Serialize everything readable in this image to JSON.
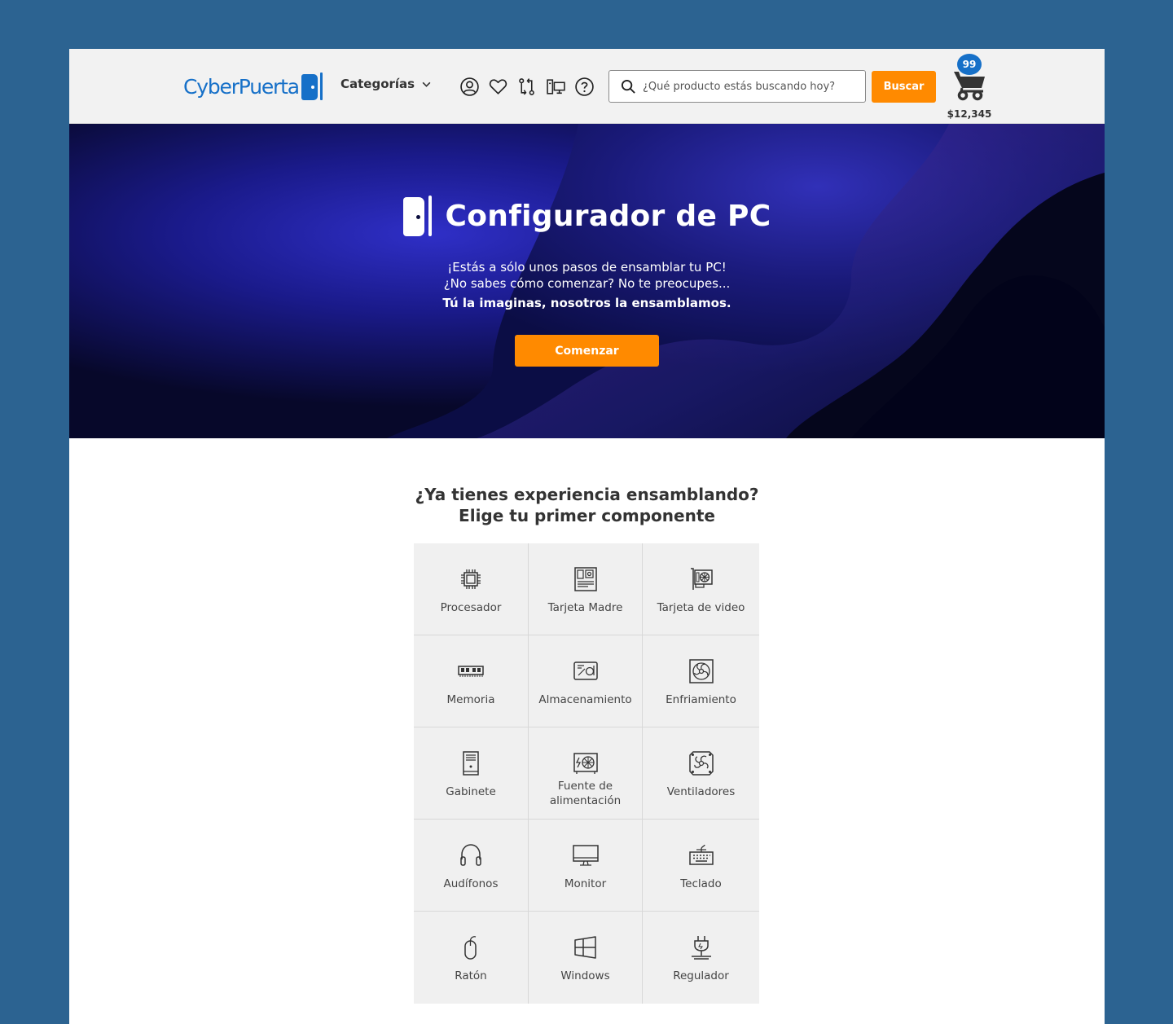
{
  "header": {
    "logo_text": "CyberPuerta",
    "categories_label": "Categorías",
    "nav_icons": [
      "account-icon",
      "heart-icon",
      "compare-icon",
      "configurator-icon",
      "help-icon"
    ],
    "search_placeholder": "¿Qué producto estás buscando hoy?",
    "search_button": "Buscar",
    "cart_count": "99",
    "cart_total": "$12,345"
  },
  "hero": {
    "title": "Configurador de PC",
    "line1": "¡Estás a sólo unos pasos de ensamblar tu PC!",
    "line2": "¿No sabes cómo comenzar? No te preocupes...",
    "tagline": "Tú la imaginas, nosotros la ensamblamos.",
    "cta": "Comenzar"
  },
  "components": {
    "title_line1": "¿Ya tienes experiencia ensamblando?",
    "title_line2": "Elige tu primer componente",
    "items": [
      {
        "label": "Procesador",
        "icon": "cpu-icon"
      },
      {
        "label": "Tarjeta Madre",
        "icon": "motherboard-icon"
      },
      {
        "label": "Tarjeta de video",
        "icon": "gpu-icon"
      },
      {
        "label": "Memoria",
        "icon": "ram-icon"
      },
      {
        "label": "Almacenamiento",
        "icon": "storage-icon"
      },
      {
        "label": "Enfriamiento",
        "icon": "cooling-icon"
      },
      {
        "label": "Gabinete",
        "icon": "case-icon"
      },
      {
        "label": "Fuente de alimentación",
        "icon": "power-supply-icon"
      },
      {
        "label": "Ventiladores",
        "icon": "fans-icon"
      },
      {
        "label": "Audífonos",
        "icon": "headphones-icon"
      },
      {
        "label": "Monitor",
        "icon": "monitor-icon"
      },
      {
        "label": "Teclado",
        "icon": "keyboard-icon"
      },
      {
        "label": "Ratón",
        "icon": "mouse-icon"
      },
      {
        "label": "Windows",
        "icon": "windows-icon"
      },
      {
        "label": "Regulador",
        "icon": "regulator-icon"
      }
    ]
  },
  "colors": {
    "page_bg": "#2c6391",
    "brand_blue": "#1670c8",
    "accent_orange": "#ff8a00",
    "hero_dark": "#0a0d3d"
  }
}
